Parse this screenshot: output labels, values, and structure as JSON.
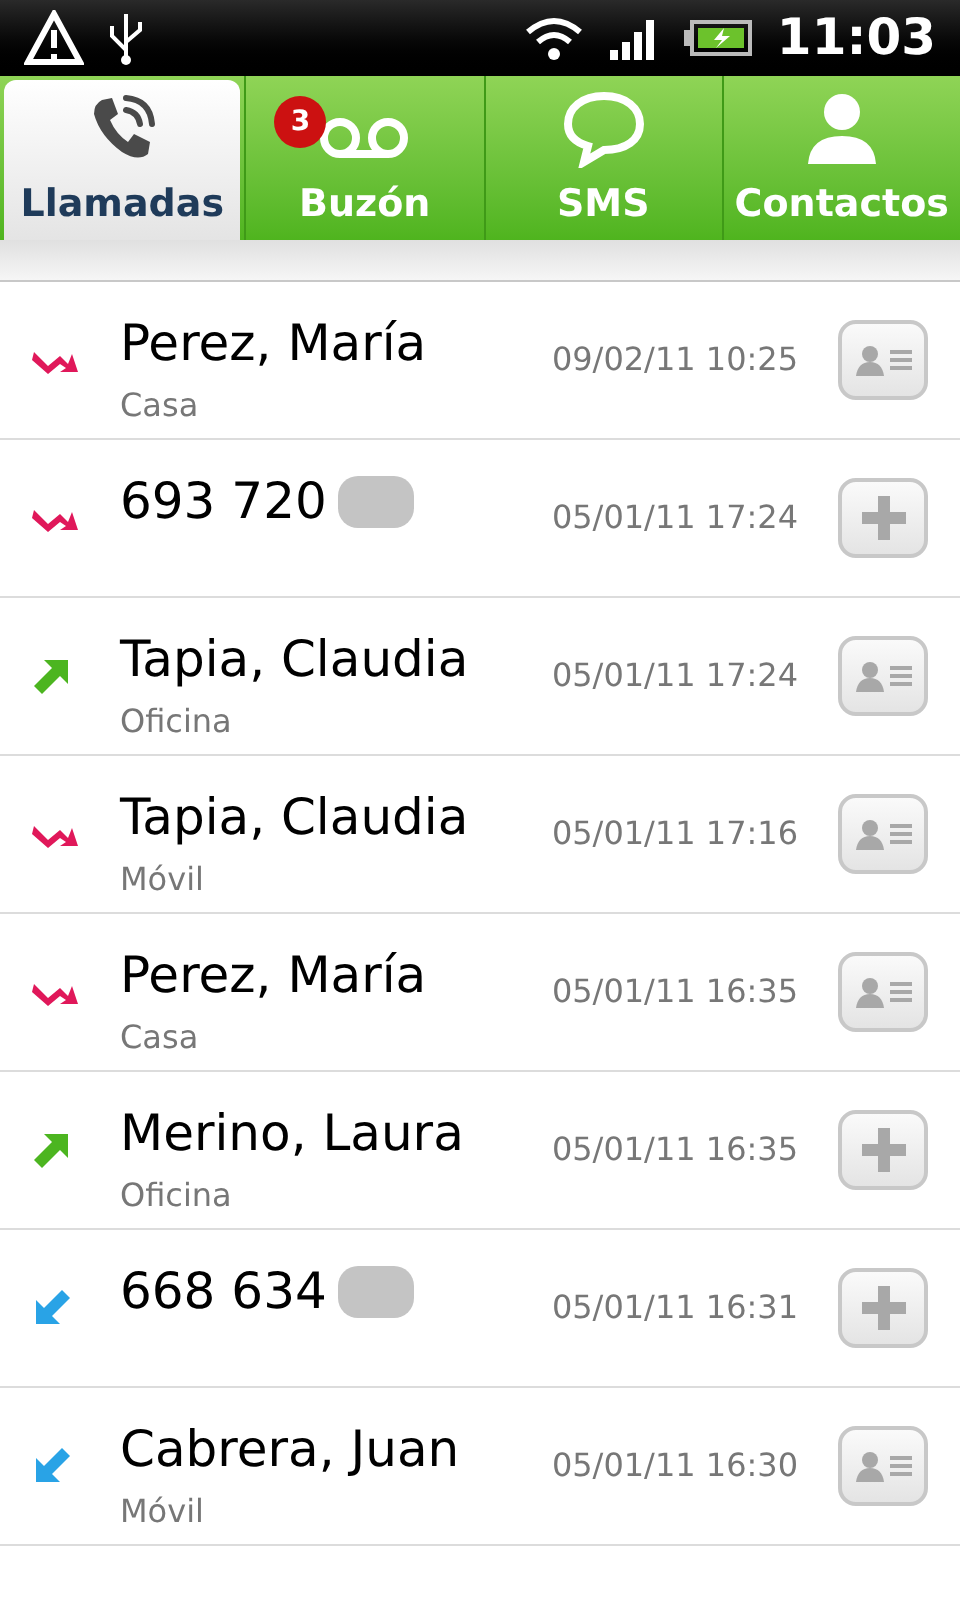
{
  "status_bar": {
    "time": "11:03"
  },
  "tabs": [
    {
      "label": "Llamadas",
      "kind": "phone",
      "selected": true
    },
    {
      "label": "Buzón",
      "kind": "voicemail",
      "selected": false,
      "badge": "3"
    },
    {
      "label": "SMS",
      "kind": "chat",
      "selected": false
    },
    {
      "label": "Contactos",
      "kind": "person",
      "selected": false
    }
  ],
  "calls": [
    {
      "name": "Perez, María",
      "label": "Casa",
      "time": "09/02/11 10:25",
      "kind": "missed",
      "in_contacts": true
    },
    {
      "name": "693 720",
      "blurred": true,
      "time": "05/01/11 17:24",
      "kind": "missed",
      "in_contacts": false
    },
    {
      "name": "Tapia, Claudia",
      "label": "Oficina",
      "time": "05/01/11 17:24",
      "kind": "outgoing",
      "in_contacts": true
    },
    {
      "name": "Tapia, Claudia",
      "label": "Móvil",
      "time": "05/01/11 17:16",
      "kind": "missed",
      "in_contacts": true
    },
    {
      "name": "Perez, María",
      "label": "Casa",
      "time": "05/01/11 16:35",
      "kind": "missed",
      "in_contacts": true
    },
    {
      "name": "Merino, Laura",
      "label": "Oficina",
      "time": "05/01/11 16:35",
      "kind": "outgoing",
      "in_contacts": false
    },
    {
      "name": "668 634",
      "blurred": true,
      "time": "05/01/11 16:31",
      "kind": "incoming",
      "in_contacts": false
    },
    {
      "name": "Cabrera, Juan",
      "label": "Móvil",
      "time": "05/01/11 16:30",
      "kind": "incoming",
      "in_contacts": true
    }
  ]
}
